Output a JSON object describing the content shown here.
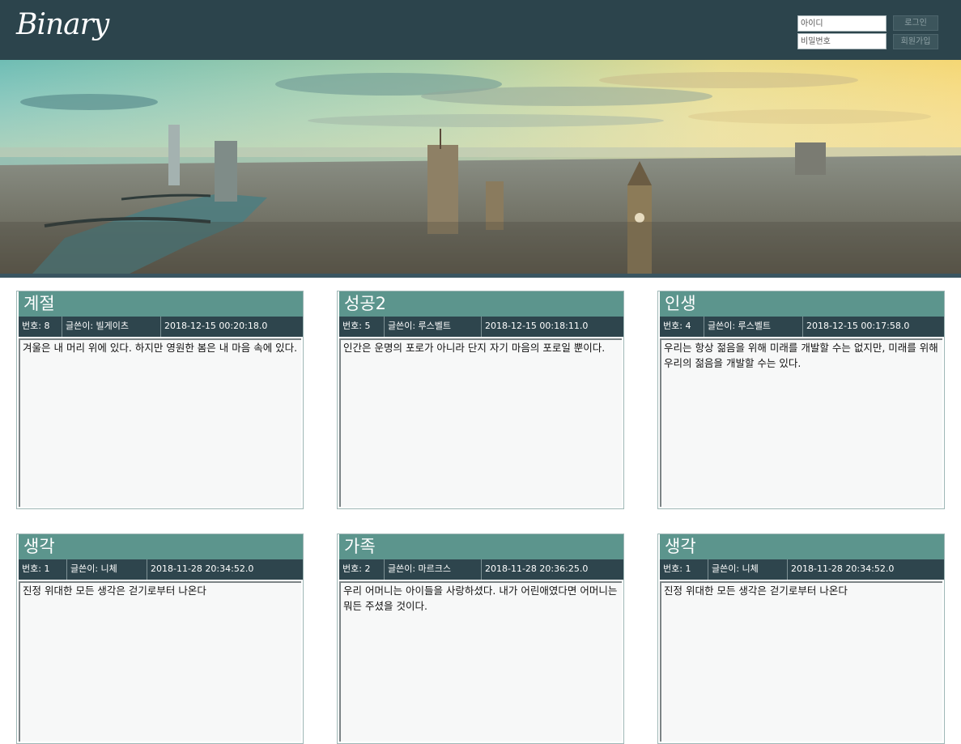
{
  "header": {
    "logo": "Binary",
    "id_placeholder": "아이디",
    "pw_placeholder": "비밀번호",
    "login_label": "로그인",
    "signup_label": "회원가입"
  },
  "posts": [
    {
      "title": "계절",
      "number": "번호: 8",
      "author": "글쓴이: 빌게이츠",
      "date": "2018-12-15 00:20:18.0",
      "content": "겨울은 내 머리 위에 있다. 하지만 영원한 봄은 내 마음 속에 있다."
    },
    {
      "title": "성공2",
      "number": "번호: 5",
      "author": "글쓴이: 루스벨트",
      "date": "2018-12-15 00:18:11.0",
      "content": "인간은 운명의 포로가 아니라 단지 자기 마음의 포로일 뿐이다."
    },
    {
      "title": "인생",
      "number": "번호: 4",
      "author": "글쓴이: 루스벨트",
      "date": "2018-12-15 00:17:58.0",
      "content": "우리는 항상 젊음을 위해 미래를 개발할 수는 없지만, 미래를 위해 우리의 젊음을 개발할 수는 있다."
    },
    {
      "title": "생각",
      "number": "번호: 1",
      "author": "글쓴이: 니체",
      "date": "2018-11-28 20:34:52.0",
      "content": "진정 위대한 모든 생각은 걷기로부터 나온다"
    },
    {
      "title": "가족",
      "number": "번호: 2",
      "author": "글쓴이: 마르크스",
      "date": "2018-11-28 20:36:25.0",
      "content": "우리 어머니는 아이들을 사랑하셨다. 내가 어린애였다면 어머니는 뭐든 주셨을 것이다."
    },
    {
      "title": "생각",
      "number": "번호: 1",
      "author": "글쓴이: 니체",
      "date": "2018-11-28 20:34:52.0",
      "content": "진정 위대한 모든 생각은 걷기로부터 나온다"
    }
  ]
}
